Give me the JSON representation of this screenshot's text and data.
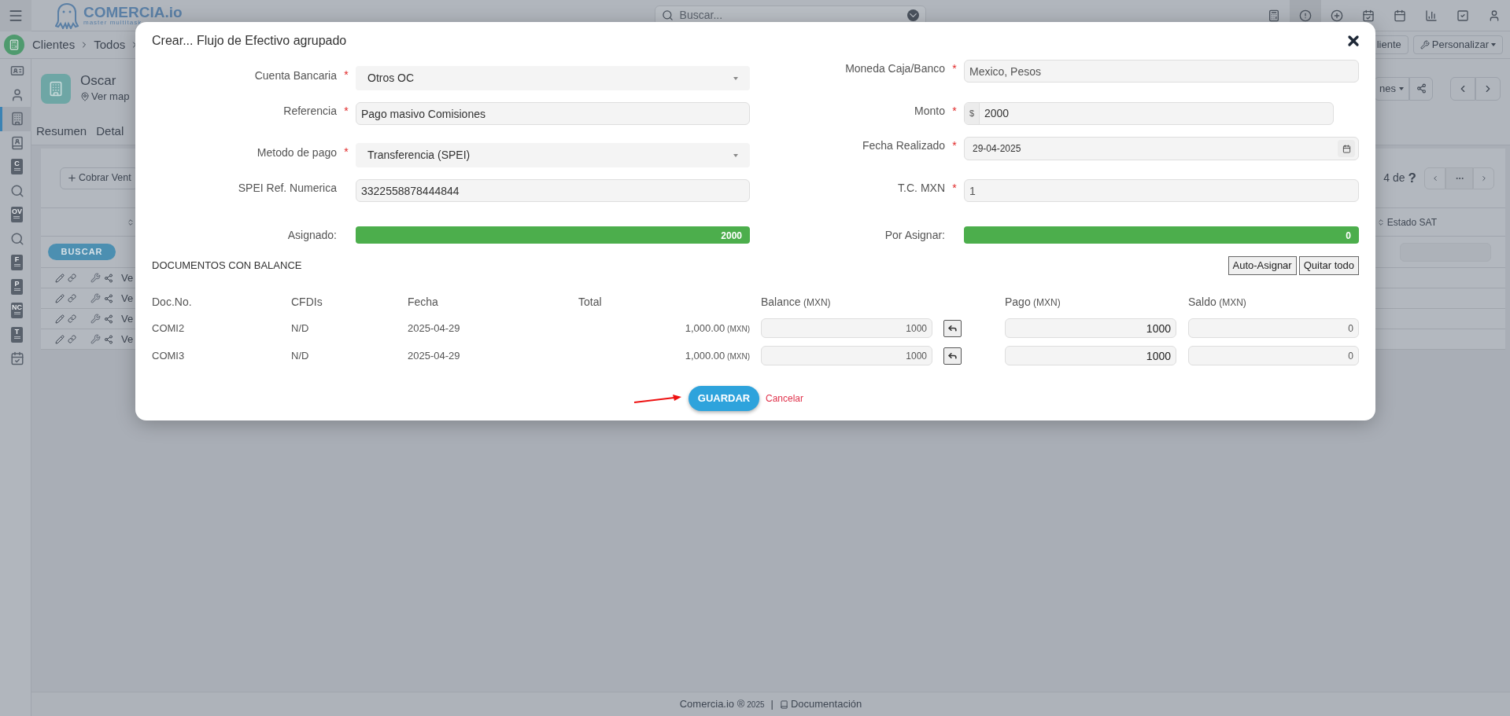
{
  "topbar": {
    "brand": "COMERCIA.io",
    "tagline": "master multitask",
    "search": {
      "placeholder": "Buscar..."
    }
  },
  "breadcrumb": {
    "items": [
      "Clientes",
      "Todos"
    ]
  },
  "header_buttons": [
    "liente",
    "Personalizar"
  ],
  "sidebar": {
    "items": [
      {
        "kind": "id-card",
        "selected": false
      },
      {
        "kind": "user",
        "selected": false
      },
      {
        "kind": "building",
        "selected": true
      },
      {
        "kind": "contacts",
        "selected": false
      },
      {
        "kind": "doc",
        "letter": "C",
        "selected": false
      },
      {
        "kind": "search",
        "selected": false
      },
      {
        "kind": "doc",
        "letter": "OV",
        "selected": false
      },
      {
        "kind": "search",
        "selected": false
      },
      {
        "kind": "doc",
        "letter": "F",
        "selected": false
      },
      {
        "kind": "doc",
        "letter": "P",
        "selected": false
      },
      {
        "kind": "doc",
        "letter": "NC",
        "selected": false
      },
      {
        "kind": "doc",
        "letter": "T",
        "selected": false
      },
      {
        "kind": "calendar",
        "selected": false
      }
    ]
  },
  "record": {
    "name": "Oscar",
    "map_link": "Ver map",
    "options_button": "nes"
  },
  "tabs": [
    "Resumen",
    "Detal"
  ],
  "list": {
    "add_button": "Cobrar Vent",
    "pager": {
      "count": "4",
      "of": "de",
      "total": "?"
    },
    "last_column": "Estado SAT",
    "search_button": "BUSCAR",
    "rows": [
      "Ve",
      "Ve",
      "Ve",
      "Ve"
    ]
  },
  "footer": {
    "brand": "Comercia.io ®",
    "year": "2025",
    "separator": "|",
    "link": "Documentación"
  },
  "modal": {
    "title": "Crear... Flujo de Efectivo agrupado",
    "fields": [
      {
        "label": "Cuenta Bancaria",
        "required_mark": "*",
        "kind": "select",
        "value": "Otros OC"
      },
      {
        "label": "Moneda Caja/Banco",
        "required_mark": "*",
        "kind": "text",
        "value": "Mexico, Pesos"
      },
      {
        "label": "Referencia",
        "required_mark": "*",
        "kind": "text",
        "value": "Pago masivo Comisiones"
      },
      {
        "label": "Monto",
        "required_mark": "*",
        "kind": "money",
        "prefix": "$",
        "value": "2000"
      },
      {
        "label": "Metodo de pago",
        "required_mark": "*",
        "kind": "select",
        "value": "Transferencia (SPEI)"
      },
      {
        "label": "Fecha Realizado",
        "required_mark": "*",
        "kind": "date",
        "value": "29-04-2025"
      },
      {
        "label": "SPEI Ref. Numerica",
        "kind": "text",
        "value": "3322558878444844"
      },
      {
        "label": "T.C. MXN",
        "required_mark": "*",
        "kind": "text",
        "value": "1"
      },
      {
        "label": "Asignado:",
        "kind": "progress",
        "level": 1,
        "value": "2000"
      },
      {
        "label": "Por Asignar:",
        "kind": "progress",
        "level": 1,
        "value": "0"
      }
    ],
    "section_title": "DOCUMENTOS CON BALANCE",
    "actions": [
      "Auto-Asignar",
      "Quitar todo"
    ],
    "columns": [
      {
        "label": "Doc.No."
      },
      {
        "label": "CFDIs"
      },
      {
        "label": "Fecha"
      },
      {
        "label": "Total"
      },
      {
        "label": "Balance",
        "unit": "(MXN)"
      },
      {
        "label": "Pago",
        "unit": "(MXN)"
      },
      {
        "label": "Saldo",
        "unit": "(MXN)"
      }
    ],
    "rows": [
      {
        "doc": "COMI2",
        "cfdis": "N/D",
        "fecha": "2025-04-29",
        "total": "1,000.00",
        "total_unit": "(MXN)",
        "balance": "1000",
        "pago": "1000",
        "saldo": "0"
      },
      {
        "doc": "COMI3",
        "cfdis": "N/D",
        "fecha": "2025-04-29",
        "total": "1,000.00",
        "total_unit": "(MXN)",
        "balance": "1000",
        "pago": "1000",
        "saldo": "0"
      }
    ],
    "save_button": "GUARDAR",
    "cancel_link": "Cancelar"
  }
}
